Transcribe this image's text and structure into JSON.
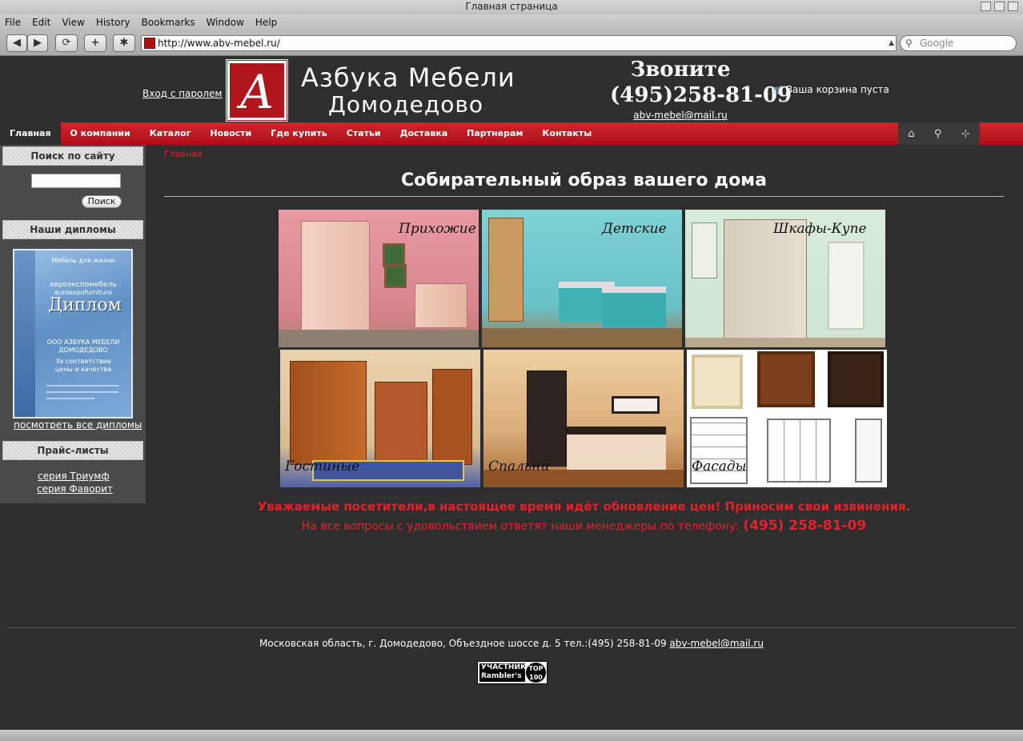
{
  "browser": {
    "title": "Главная страница",
    "menu": [
      "File",
      "Edit",
      "View",
      "History",
      "Bookmarks",
      "Window",
      "Help"
    ],
    "url": "http://www.abv-mebel.ru/",
    "search_placeholder": "Google"
  },
  "header": {
    "login": "Вход с паролем",
    "brand_line1": "Азбука Мебели",
    "brand_line2": "Домодедово",
    "call_title": "Звоните",
    "phone": "(495)258-81-09",
    "email": "abv-mebel@mail.ru",
    "cart": "Ваша корзина пуста"
  },
  "nav": {
    "items": [
      "Главная",
      "О компании",
      "Каталог",
      "Новости",
      "Где купить",
      "Статьи",
      "Доставка",
      "Партнерам",
      "Контакты"
    ],
    "active": "Главная",
    "tools": [
      "home-icon",
      "search-icon",
      "sitemap-icon"
    ]
  },
  "sidebar": {
    "search_title": "Поиск по сайту",
    "search_button": "Поиск",
    "diplomas_title": "Наши дипломы",
    "diploma_text": {
      "top": "Мебель для жизни",
      "org": "евроэкспомебель",
      "org_en": "euroexpofurniture",
      "title": "Диплом",
      "company": "ООО АЗБУКА МЕБЕЛИ ДОМОДЕДОВО",
      "line": "За соответствие",
      "line2": "цены и качества"
    },
    "diplomas_link": "посмотреть все дипломы",
    "prices_title": "Прайс-листы",
    "price_links": [
      "серия Триумф",
      "серия Фаворит"
    ]
  },
  "main": {
    "breadcrumb": "Главная",
    "title": "Собирательный образ вашего дома",
    "tiles": [
      "Прихожие",
      "Детские",
      "Шкафы-Купе",
      "Гостиные",
      "Спальни",
      "Фасады"
    ],
    "notice1": "Уважаемые посетители,в настоящее время идёт обновление цен! Приносим свои извинения.",
    "notice2": "На все вопросы с удовольствием ответят наши менеджеры по телефону:",
    "notice2_phone": "(495) 258-81-09"
  },
  "footer": {
    "address": "Московская область, г. Домодедово, Объездное шоссе д. 5 тел.:(495) 258-81-09",
    "email": "abv-mebel@mail.ru",
    "counter_top": "УЧАСТНИК",
    "counter_bottom": "Rambler's",
    "counter_badge_1": "TOP",
    "counter_badge_2": "100"
  },
  "colors": {
    "accent_red": "#d2262f",
    "background": "#2e2e2e",
    "notice_red": "#e0222a"
  }
}
